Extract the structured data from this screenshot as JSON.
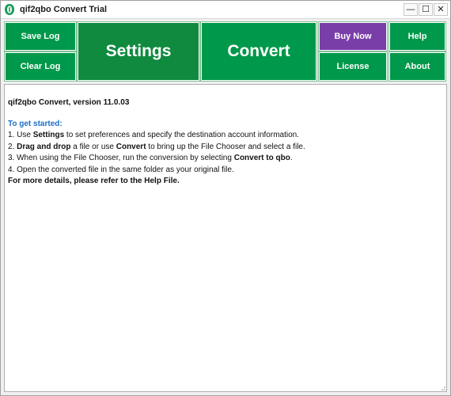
{
  "window": {
    "title": "qif2qbo Convert Trial",
    "controls": {
      "minimize": "—",
      "maximize": "☐",
      "close": "✕"
    }
  },
  "toolbar": {
    "save_log": "Save Log",
    "clear_log": "Clear Log",
    "settings": "Settings",
    "convert": "Convert",
    "buy_now": "Buy Now",
    "help": "Help",
    "license": "License",
    "about": "About"
  },
  "colors": {
    "button_green": "#00984a",
    "button_dark_green": "#0f8a3f",
    "buy_now_purple": "#7a3ea8",
    "heading_blue": "#1f6fc4"
  },
  "log": {
    "version_line": "qif2qbo Convert, version 11.0.03",
    "getting_started": "To get started:",
    "step1": {
      "prefix": "1. Use ",
      "bold": "Settings",
      "suffix": " to set preferences and specify the destination account information."
    },
    "step2": {
      "prefix": "2. ",
      "bold1": "Drag and drop",
      "middle": " a file or use ",
      "bold2": "Convert",
      "suffix": " to bring up the File Chooser and select a file."
    },
    "step3": {
      "prefix": "3. When using the File Chooser, run the conversion by selecting ",
      "bold": "Convert to qbo",
      "suffix": "."
    },
    "step4": "4. Open the converted file in the same folder as your original file.",
    "more_details": "For more details, please refer to the Help File."
  }
}
